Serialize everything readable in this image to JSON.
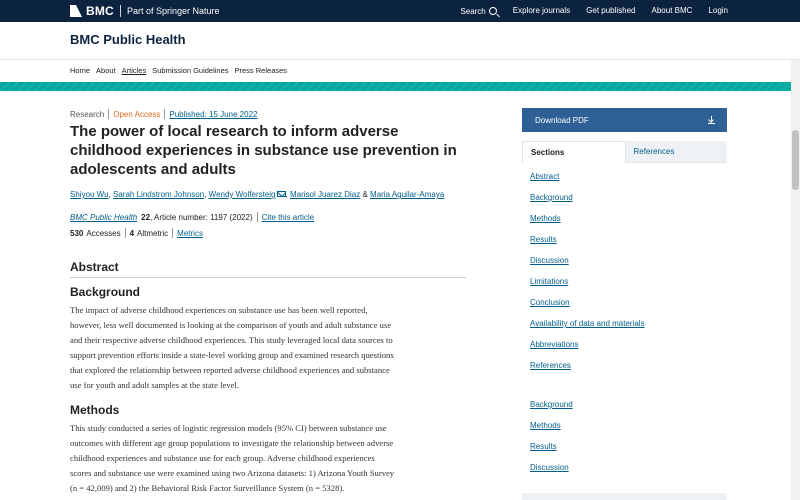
{
  "topbar": {
    "brand": "BMC",
    "tagline": "Part of Springer Nature",
    "nav": [
      "Search",
      "Explore journals",
      "Get published",
      "About BMC",
      "Login"
    ]
  },
  "journal": {
    "title": "BMC Public Health",
    "nav": [
      "Home",
      "About",
      "Articles",
      "Submission Guidelines",
      "Press Releases"
    ],
    "active_nav": "Articles"
  },
  "article": {
    "type": "Research",
    "access": "Open Access",
    "published": "Published: 15 June 2022",
    "title": "The power of local research to inform adverse childhood experiences in substance use prevention in adolescents and adults",
    "authors": [
      "Shiyou Wu",
      "Sarah Lindstrom Johnson",
      "Wendy Wolfersteig",
      "Marisol Juarez Diaz",
      "Maria Aguilar-Amaya"
    ],
    "author_sep": ",",
    "author_amp": "&",
    "journal_name": "BMC Public Health",
    "volume": "22",
    "article_number": ", Article number: 1197 (2022)",
    "cite": "Cite this article",
    "accesses_count": "530",
    "accesses_label": "Accesses",
    "altmetric_count": "4",
    "altmetric_label": "Altmetric",
    "metrics": "Metrics"
  },
  "abstract": {
    "heading": "Abstract",
    "background_heading": "Background",
    "background_lines": [
      "The impact of adverse childhood experiences on substance use has been well reported,",
      "however, less well documented is looking at the comparison of youth and adult substance use",
      "and their respective adverse childhood experiences. This study leveraged local data sources to",
      "support prevention efforts inside a state-level working group and examined research questions",
      "that explored the relationship between reported adverse childhood experiences and substance",
      "use for youth and adult samples at the state level."
    ],
    "methods_heading": "Methods",
    "methods_lines": [
      "This study conducted a series of logistic regression models (95% CI) between substance use",
      "outcomes with different age group populations to investigate the relationship between adverse",
      "childhood experiences and substance use for each group. Adverse childhood experiences",
      "scores and substance use were examined using two Arizona datasets: 1) Arizona Youth Survey",
      "(n = 42,009) and 2) the Behavioral Risk Factor Surveillance System (n = 5328)."
    ]
  },
  "sidebar": {
    "download": "Download PDF",
    "tabs": [
      "Sections",
      "References"
    ],
    "sections": [
      "Abstract",
      "Background",
      "Methods",
      "Results",
      "Discussion",
      "Limitations",
      "Conclusion",
      "Availability of data and materials",
      "Abbreviations",
      "References"
    ],
    "sections_repeat": [
      "Background",
      "Methods",
      "Results",
      "Discussion"
    ]
  },
  "colors": {
    "topbar": "#0c2340",
    "accent_teal": "#00a9a1",
    "link": "#025e8d",
    "open_access": "#e06c1d",
    "button": "#2e6095"
  }
}
